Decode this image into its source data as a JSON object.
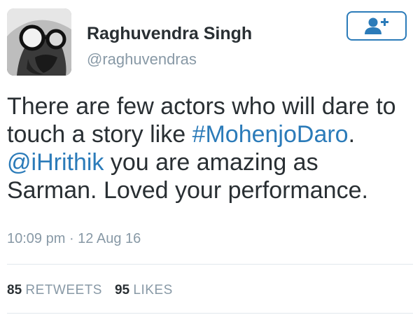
{
  "user": {
    "display_name": "Raghuvendra Singh",
    "handle": "@raghuvendras"
  },
  "follow_button": {
    "icon": "add-user-icon",
    "color": "#2b7bb9"
  },
  "tweet": {
    "line1": "There are few actors who will dare to",
    "line2_text": "touch a story like ",
    "line2_hashtag": "#MohenjoDaro",
    "line2_end": ".",
    "line3_mention": "@iHrithik",
    "line3_text": " you are amazing as",
    "line4": "Sarman. Loved your performance.",
    "link_color": "#2b7bb9"
  },
  "timestamp": "10:09 pm · 12 Aug 16",
  "stats": {
    "retweets_count": "85",
    "retweets_label": "RETWEETS",
    "likes_count": "95",
    "likes_label": "LIKES"
  }
}
